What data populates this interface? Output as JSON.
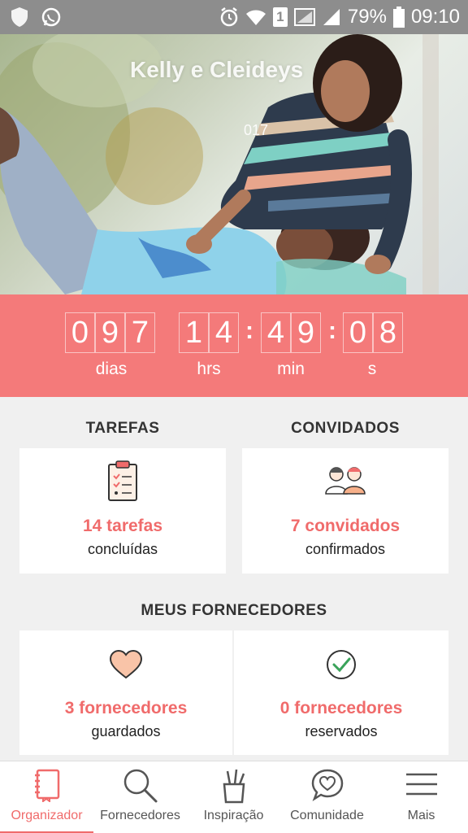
{
  "status_bar": {
    "battery": "79%",
    "time": "09:10",
    "sim_badge": "1"
  },
  "hero": {
    "title": "Kelly e Cleideys",
    "date_fragment": "017"
  },
  "countdown": {
    "days": [
      "0",
      "9",
      "7"
    ],
    "hours": [
      "1",
      "4"
    ],
    "minutes": [
      "4",
      "9"
    ],
    "seconds": [
      "0",
      "8"
    ],
    "labels": {
      "days": "dias",
      "hours": "hrs",
      "minutes": "min",
      "seconds": "s"
    },
    "separator": ":"
  },
  "tasks": {
    "heading": "TAREFAS",
    "count": "14 tarefas",
    "status": "concluídas"
  },
  "guests": {
    "heading": "CONVIDADOS",
    "count": "7 convidados",
    "status": "confirmados"
  },
  "vendors": {
    "heading": "MEUS FORNECEDORES",
    "saved_count": "3 fornecedores",
    "saved_status": "guardados",
    "booked_count": "0 fornecedores",
    "booked_status": "reservados"
  },
  "nav": {
    "items": [
      {
        "label": "Organizador",
        "icon": "notebook-icon"
      },
      {
        "label": "Fornecedores",
        "icon": "search-icon"
      },
      {
        "label": "Inspiração",
        "icon": "cup-pencils-icon"
      },
      {
        "label": "Comunidade",
        "icon": "chat-heart-icon"
      },
      {
        "label": "Mais",
        "icon": "hamburger-menu-icon"
      }
    ]
  },
  "colors": {
    "accent": "#f47a7a",
    "accent_text": "#f06b6b",
    "status_bar": "#8d8d8d",
    "background": "#f0f0f0"
  }
}
